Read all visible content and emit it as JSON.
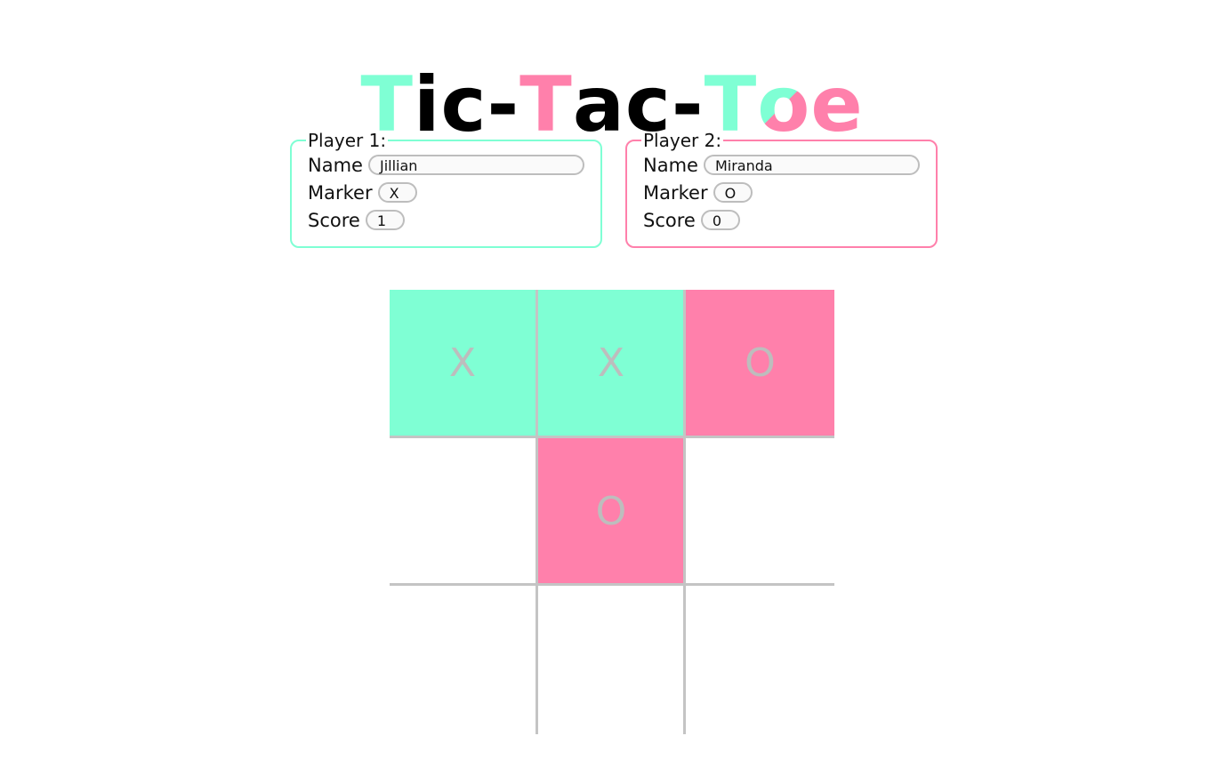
{
  "title": {
    "parts": [
      "T",
      "ic-",
      "T",
      "ac-",
      "T",
      "o",
      "e"
    ]
  },
  "colors": {
    "player1": "#7fffd4",
    "player2": "#ff80ab"
  },
  "players": [
    {
      "legend": "Player 1:",
      "name_label": "Name",
      "name_value": "Jillian",
      "marker_label": "Marker",
      "marker_value": "X",
      "score_label": "Score",
      "score_value": "1"
    },
    {
      "legend": "Player 2:",
      "name_label": "Name",
      "name_value": "Miranda",
      "marker_label": "Marker",
      "marker_value": "O",
      "score_label": "Score",
      "score_value": "0"
    }
  ],
  "board": {
    "cells": [
      "X",
      "X",
      "O",
      "",
      "O",
      "",
      "",
      "",
      ""
    ]
  }
}
